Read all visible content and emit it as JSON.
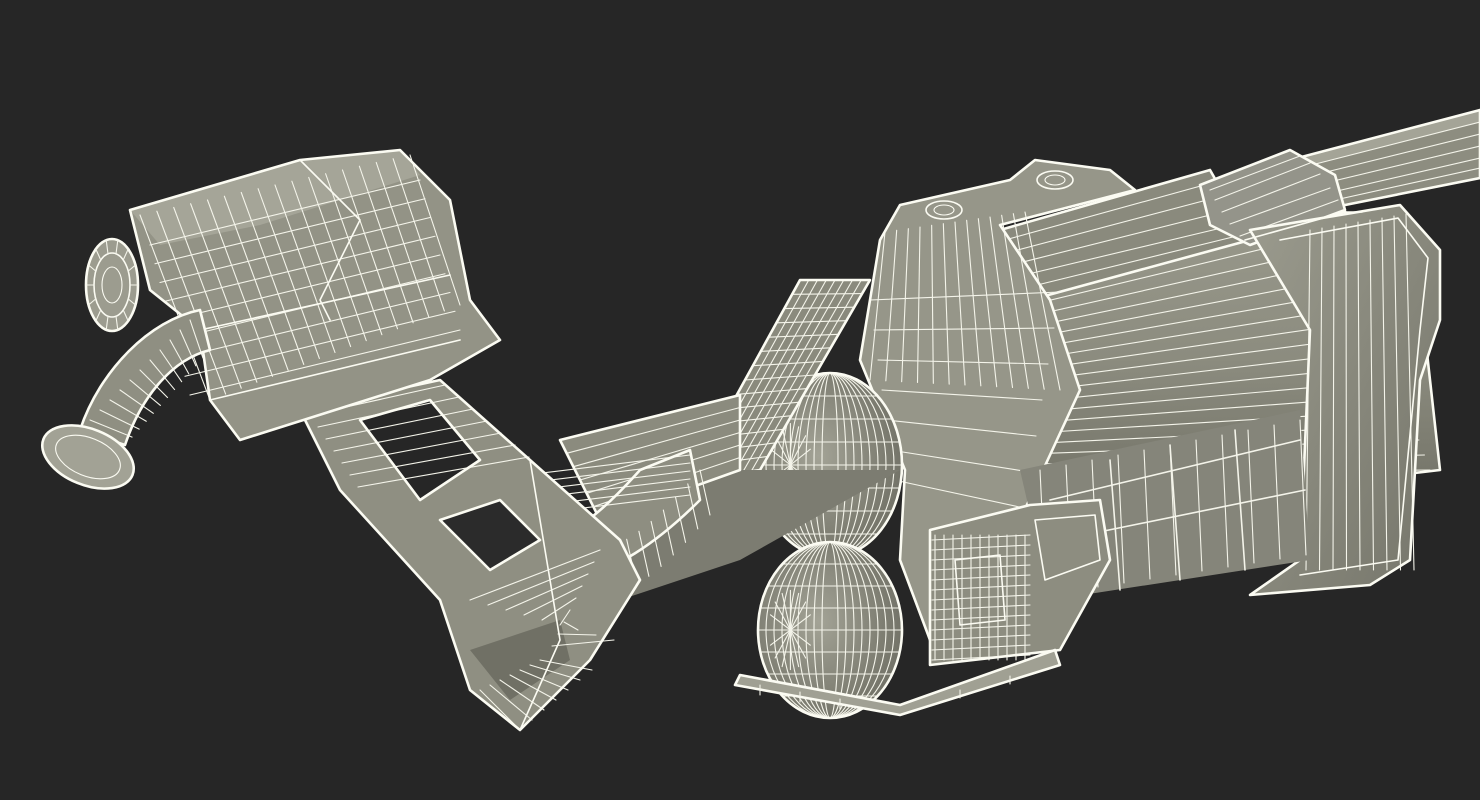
{
  "scene": {
    "background": "#262626",
    "surface": "#8f8f82",
    "surface_shadow": "#6d6d62",
    "surface_light": "#a8a89b",
    "wire": "#f4f4ea"
  }
}
